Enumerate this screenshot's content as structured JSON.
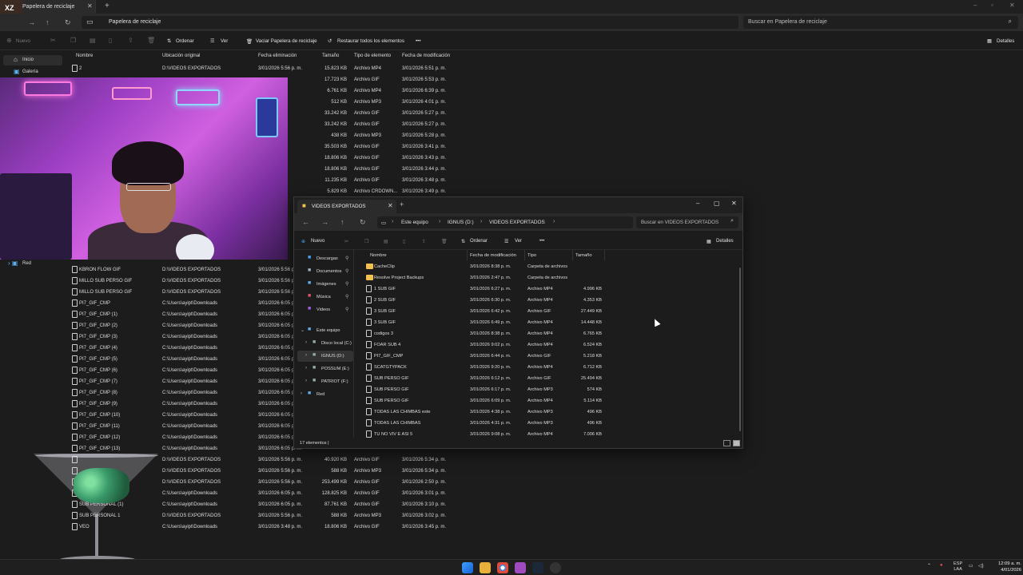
{
  "recycle_bin": {
    "tab_title": "Papelera de reciclaje",
    "address": "Papelera de reciclaje",
    "search_placeholder": "Buscar en Papelera de reciclaje",
    "commands": {
      "new": "Nuevo",
      "sort": "Ordenar",
      "view": "Ver",
      "empty_bin": "Vaciar Papelera de reciclaje",
      "restore_all": "Restaurar todos los elementos",
      "details": "Detalles",
      "more": "•••"
    },
    "nav": [
      "Inicio",
      "Galería",
      "Red"
    ],
    "columns": [
      "Nombre",
      "Ubicación original",
      "Fecha eliminación",
      "Tamaño",
      "Tipo de elemento",
      "Fecha de modificación"
    ],
    "rows_top": [
      {
        "name": "2",
        "loc": "D:\\VIDEOS EXPORTADOS",
        "del": "3/01/2026 5:56 p. m.",
        "size": "15.823 KB",
        "type": "Archivo MP4",
        "mod": "3/01/2026 5:51 p. m."
      },
      {
        "name": "",
        "loc": "",
        "del": "",
        "size": "17.723 KB",
        "type": "Archivo GIF",
        "mod": "3/01/2026 5:53 p. m."
      },
      {
        "name": "",
        "loc": "",
        "del": "",
        "size": "6.761 KB",
        "type": "Archivo MP4",
        "mod": "3/01/2026 6:39 p. m."
      },
      {
        "name": "",
        "loc": "",
        "del": "",
        "size": "512 KB",
        "type": "Archivo MP3",
        "mod": "3/01/2026 4:01 p. m."
      },
      {
        "name": "",
        "loc": "",
        "del": "",
        "size": "33.242 KB",
        "type": "Archivo GIF",
        "mod": "3/01/2026 5:27 p. m."
      },
      {
        "name": "",
        "loc": "",
        "del": "",
        "size": "33.242 KB",
        "type": "Archivo GIF",
        "mod": "3/01/2026 5:27 p. m."
      },
      {
        "name": "",
        "loc": "",
        "del": "",
        "size": "438 KB",
        "type": "Archivo MP3",
        "mod": "3/01/2026 5:28 p. m."
      },
      {
        "name": "",
        "loc": "",
        "del": "",
        "size": "35.503 KB",
        "type": "Archivo GIF",
        "mod": "3/01/2026 3:41 p. m."
      },
      {
        "name": "",
        "loc": "",
        "del": "",
        "size": "18.806 KB",
        "type": "Archivo GIF",
        "mod": "3/01/2026 3:43 p. m."
      },
      {
        "name": "",
        "loc": "",
        "del": "",
        "size": "18.806 KB",
        "type": "Archivo GIF",
        "mod": "3/01/2026 3:44 p. m."
      },
      {
        "name": "",
        "loc": "",
        "del": "",
        "size": "11.235 KB",
        "type": "Archivo GIF",
        "mod": "3/01/2026 3:48 p. m."
      },
      {
        "name": "",
        "loc": "",
        "del": "",
        "size": "5.829 KB",
        "type": "Archivo CRDOWN...",
        "mod": "3/01/2026 3:49 p. m."
      }
    ],
    "rows_bottom": [
      {
        "name": "KBRON FLOW GIF",
        "loc": "D:\\VIDEOS EXPORTADOS",
        "del": "3/01/2026 5:56 p. m."
      },
      {
        "name": "MILLO SUB PERSO GIF",
        "loc": "D:\\VIDEOS EXPORTADOS",
        "del": "3/01/2026 5:56 p. m."
      },
      {
        "name": "MILLO SUB PERSO GIF",
        "loc": "D:\\VIDEOS EXPORTADOS",
        "del": "3/01/2026 5:56 p. m."
      },
      {
        "name": "PI7_GIF_CMP",
        "loc": "C:\\Users\\ayipt\\Downloads",
        "del": "3/01/2026 6:05 p. m."
      },
      {
        "name": "PI7_GIF_CMP (1)",
        "loc": "C:\\Users\\ayipt\\Downloads",
        "del": "3/01/2026 6:05 p. m."
      },
      {
        "name": "PI7_GIF_CMP (2)",
        "loc": "C:\\Users\\ayipt\\Downloads",
        "del": "3/01/2026 6:05 p. m."
      },
      {
        "name": "PI7_GIF_CMP (3)",
        "loc": "C:\\Users\\ayipt\\Downloads",
        "del": "3/01/2026 6:05 p. m."
      },
      {
        "name": "PI7_GIF_CMP (4)",
        "loc": "C:\\Users\\ayipt\\Downloads",
        "del": "3/01/2026 6:05 p. m."
      },
      {
        "name": "PI7_GIF_CMP (5)",
        "loc": "C:\\Users\\ayipt\\Downloads",
        "del": "3/01/2026 6:05 p. m."
      },
      {
        "name": "PI7_GIF_CMP (6)",
        "loc": "C:\\Users\\ayipt\\Downloads",
        "del": "3/01/2026 6:05 p. m."
      },
      {
        "name": "PI7_GIF_CMP (7)",
        "loc": "C:\\Users\\ayipt\\Downloads",
        "del": "3/01/2026 6:05 p. m."
      },
      {
        "name": "PI7_GIF_CMP (8)",
        "loc": "C:\\Users\\ayipt\\Downloads",
        "del": "3/01/2026 6:05 p. m."
      },
      {
        "name": "PI7_GIF_CMP (9)",
        "loc": "C:\\Users\\ayipt\\Downloads",
        "del": "3/01/2026 6:05 p. m."
      },
      {
        "name": "PI7_GIF_CMP (10)",
        "loc": "C:\\Users\\ayipt\\Downloads",
        "del": "3/01/2026 6:05 p. m."
      },
      {
        "name": "PI7_GIF_CMP (11)",
        "loc": "C:\\Users\\ayipt\\Downloads",
        "del": "3/01/2026 6:05 p. m."
      },
      {
        "name": "PI7_GIF_CMP (12)",
        "loc": "C:\\Users\\ayipt\\Downloads",
        "del": "3/01/2026 6:05 p. m."
      },
      {
        "name": "PI7_GIF_CMP (13)",
        "loc": "C:\\Users\\ayipt\\Downloads",
        "del": "3/01/2026 6:05 p. m."
      },
      {
        "name": "",
        "loc": "D:\\VIDEOS EXPORTADOS",
        "del": "3/01/2026 5:56 p. m.",
        "size": "40.920 KB",
        "type": "Archivo GIF",
        "mod": "3/01/2026 5:34 p. m."
      },
      {
        "name": "",
        "loc": "D:\\VIDEOS EXPORTADOS",
        "del": "3/01/2026 5:56 p. m.",
        "size": "588 KB",
        "type": "Archivo MP3",
        "mod": "3/01/2026 5:34 p. m."
      },
      {
        "name": "",
        "loc": "D:\\VIDEOS EXPORTADOS",
        "del": "3/01/2026 5:56 p. m.",
        "size": "253.499 KB",
        "type": "Archivo GIF",
        "mod": "3/01/2026 2:50 p. m."
      },
      {
        "name": "",
        "loc": "C:\\Users\\ayipt\\Downloads",
        "del": "3/01/2026 6:05 p. m.",
        "size": "128.825 KB",
        "type": "Archivo GIF",
        "mod": "3/01/2026 3:01 p. m."
      },
      {
        "name": "SUB PERSONAL (1)",
        "loc": "C:\\Users\\ayipt\\Downloads",
        "del": "3/01/2026 6:05 p. m.",
        "size": "87.761 KB",
        "type": "Archivo GIF",
        "mod": "3/01/2026 3:10 p. m."
      },
      {
        "name": "SUB PERSONAL 1",
        "loc": "D:\\VIDEOS EXPORTADOS",
        "del": "3/01/2026 5:56 p. m.",
        "size": "588 KB",
        "type": "Archivo MP3",
        "mod": "3/01/2026 3:02 p. m."
      },
      {
        "name": "VEO",
        "loc": "C:\\Users\\ayipt\\Downloads",
        "del": "3/01/2026 3:48 p. m.",
        "size": "18.806 KB",
        "type": "Archivo GIF",
        "mod": "3/01/2026 3:45 p. m."
      }
    ]
  },
  "videos_window": {
    "tab_title": "VIDEOS EXPORTADOS",
    "crumbs": [
      "Este equipo",
      "IGNUS (D:)",
      "VIDEOS EXPORTADOS"
    ],
    "search_placeholder": "Buscar en VIDEOS EXPORTADOS",
    "commands": {
      "new": "Nuevo",
      "sort": "Ordenar",
      "view": "Ver",
      "details": "Detalles",
      "more": "•••"
    },
    "nav": [
      {
        "label": "Descargas",
        "icon": "download-icon",
        "color": "#4aa3f0"
      },
      {
        "label": "Documentos",
        "icon": "documents-icon",
        "color": "#9db0c8"
      },
      {
        "label": "Imágenes",
        "icon": "pictures-icon",
        "color": "#5ab0f0"
      },
      {
        "label": "Música",
        "icon": "music-icon",
        "color": "#e05070"
      },
      {
        "label": "Videos",
        "icon": "videos-icon",
        "color": "#a060e0"
      },
      {
        "label": "Este equipo",
        "icon": "this-pc-icon",
        "color": "#5ab0f0"
      },
      {
        "label": "Disco local (C:)",
        "icon": "drive-icon",
        "color": "#9aa"
      },
      {
        "label": "IGNUS (D:)",
        "icon": "drive-icon",
        "color": "#9aa"
      },
      {
        "label": "POSSUM (E:)",
        "icon": "drive-icon",
        "color": "#9aa"
      },
      {
        "label": "PATRIOT (F:)",
        "icon": "drive-icon",
        "color": "#9aa"
      },
      {
        "label": "Red",
        "icon": "network-icon",
        "color": "#5ab0f0"
      }
    ],
    "columns": [
      "Nombre",
      "Fecha de modificación",
      "Tipo",
      "Tamaño"
    ],
    "files": [
      {
        "name": "CacheClip",
        "mod": "3/01/2026 8:38 p. m.",
        "type": "Carpeta de archivos",
        "size": "",
        "folder": true
      },
      {
        "name": "Resolve Project Backups",
        "mod": "3/01/2026 2:47 p. m.",
        "type": "Carpeta de archivos",
        "size": "",
        "folder": true
      },
      {
        "name": "1 SUB GIF",
        "mod": "3/01/2026 6:27 p. m.",
        "type": "Archivo MP4",
        "size": "4.996 KB"
      },
      {
        "name": "2 SUB GIF",
        "mod": "3/01/2026 6:30 p. m.",
        "type": "Archivo MP4",
        "size": "4.353 KB"
      },
      {
        "name": "3 SUB GIF",
        "mod": "3/01/2026 6:42 p. m.",
        "type": "Archivo GIF",
        "size": "27.449 KB"
      },
      {
        "name": "3 SUB GIF",
        "mod": "3/01/2026 6:49 p. m.",
        "type": "Archivo MP4",
        "size": "14.448 KB"
      },
      {
        "name": "codigos 3",
        "mod": "3/01/2026 8:38 p. m.",
        "type": "Archivo MP4",
        "size": "6.765 KB"
      },
      {
        "name": "FOAR SUB 4",
        "mod": "3/01/2026 9:02 p. m.",
        "type": "Archivo MP4",
        "size": "6.524 KB"
      },
      {
        "name": "PI7_GIF_CMP",
        "mod": "3/01/2026 6:44 p. m.",
        "type": "Archivo GIF",
        "size": "5.218 KB"
      },
      {
        "name": "SCATGTYPACK",
        "mod": "3/01/2026 9:20 p. m.",
        "type": "Archivo MP4",
        "size": "6.712 KB"
      },
      {
        "name": "SUB PERSO GIF",
        "mod": "3/01/2026 6:12 p. m.",
        "type": "Archivo GIF",
        "size": "25.494 KB"
      },
      {
        "name": "SUB PERSO GIF",
        "mod": "3/01/2026 6:17 p. m.",
        "type": "Archivo MP3",
        "size": "574 KB"
      },
      {
        "name": "SUB PERSO GIF",
        "mod": "3/01/2026 6:09 p. m.",
        "type": "Archivo MP4",
        "size": "5.114 KB"
      },
      {
        "name": "TODAS LAS CHIMBAS este",
        "mod": "3/01/2026 4:38 p. m.",
        "type": "Archivo MP3",
        "size": "496 KB"
      },
      {
        "name": "TODAS LAS CHIMBAS",
        "mod": "3/01/2026 4:31 p. m.",
        "type": "Archivo MP3",
        "size": "496 KB"
      },
      {
        "name": "TU NO VIV E ASI 5",
        "mod": "3/01/2026 9:08 p. m.",
        "type": "Archivo MP4",
        "size": "7.006 KB"
      }
    ],
    "status": "17 elementos  |"
  },
  "taskbar": {
    "lang_top": "ESP",
    "lang_bottom": "LAA",
    "time": "12:09 a. m.",
    "date": "4/01/2026"
  },
  "overlay": {
    "logo_text": "XZ"
  }
}
